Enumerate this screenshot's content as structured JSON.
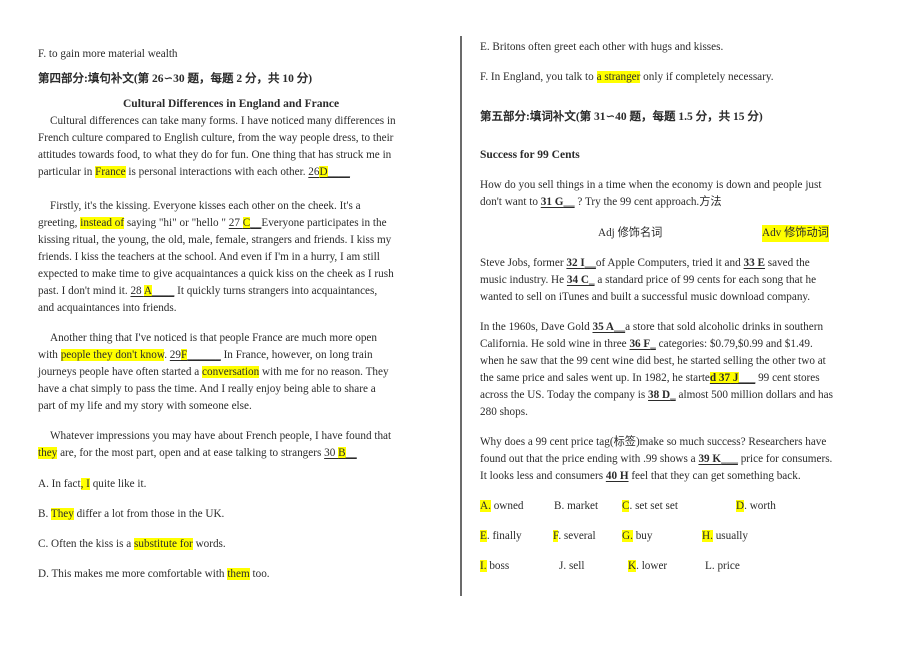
{
  "left": {
    "prev_option_f": "F. to gain more material wealth",
    "section4_heading": "第四部分:填句补文(第 26∽30 题，每题 2 分，共 10 分)",
    "passage_title": "Cultural Differences in England and France",
    "p1": {
      "l1": "Cultural differences can take many forms. I have noticed many differences in",
      "l2": "French culture compared to English culture, from the way people dress, to their",
      "l3": "attitudes towards food, to what they do for fun. One thing that has struck me in",
      "l4a": "particular in ",
      "l4hl": "France",
      "l4b": " is personal interactions with each other. ",
      "blank26_num": "26",
      "blank26_ans": "D",
      "blank26_tail": "____"
    },
    "p2": {
      "l1": "Firstly, it's the kissing. Everyone kisses each other on the cheek. It's a",
      "l2a": "greeting, ",
      "l2hl": "instead of",
      "l2b": " saying \"hi\" or \"hello \" ",
      "blank27_num": "27 ",
      "blank27_ans": "C",
      "blank27_tail": "__",
      "l2c": "Everyone participates in the",
      "l3": "kissing ritual, the young, the old, male, female, strangers and friends. I kiss my",
      "l4": "friends. I kiss the teachers at the school. And even if I'm in a hurry, I am still",
      "l5": "expected to make time to give acquaintances a quick kiss on the cheek as I rush",
      "l6a": "past. I don't mind it. ",
      "blank28_num": "28 ",
      "blank28_ans": "A",
      "blank28_tail": "____",
      "l6b": "  It quickly turns strangers into acquaintances,",
      "l7": "and acquaintances into friends."
    },
    "p3": {
      "l1": "Another thing that I've noticed is that people France are much more open",
      "l2a": "with ",
      "l2hl": "people they don't know",
      "l2b": ". ",
      "blank29_num": "29",
      "blank29_ans": "F",
      "blank29_tail": "______",
      "l2c": "  In France, however, on long train",
      "l3a": "journeys people have often started a ",
      "l3hl": "conversation",
      "l3b": " with me for no reason. They",
      "l4": "have a chat simply to pass the time. And I really enjoy being able to share a",
      "l5": "part of my life and my story with someone else."
    },
    "p4": {
      "l1": "Whatever impressions you may have about French people, I have found that",
      "l2hl": "they",
      "l2b": " are, for the most part, open and at ease talking to strangers ",
      "blank30_num": "30 ",
      "blank30_ans": "B",
      "blank30_tail": "__"
    },
    "options": [
      {
        "pre": "A. In fact",
        "hl": ", I",
        "post": " quite like it."
      },
      {
        "pre": "B. ",
        "hl": "They",
        "post": " differ a lot from those in the UK."
      },
      {
        "pre": "C. Often the kiss is a ",
        "hl": "substitute for",
        "post": " words."
      },
      {
        "pre": "D. This makes me more comfortable with ",
        "hl": "them",
        "post": " too."
      }
    ]
  },
  "right": {
    "option_e": "E. Britons often greet each other with hugs and kisses.",
    "option_f_pre": "F. In England, you talk to ",
    "option_f_hl": "a stranger",
    "option_f_post": " only if completely necessary.",
    "section5_heading": "第五部分:填词补文(第 31∽40 题，每题 1.5 分，共 15 分)",
    "passage_title": "Success for 99 Cents",
    "p1": {
      "l1": "How do you sell things in a time when the economy is down and people just",
      "l2a": "don't want to ",
      "blank31": "31 G",
      "blank31_tail": "__",
      "l2b": "  ? Try the 99 cent approach.方法"
    },
    "notes": {
      "adj": "Adj 修饰名词",
      "adv": "Adv 修饰动词"
    },
    "p2": {
      "l1a": "Steve Jobs, former ",
      "blank32": "32 I",
      "blank32_tail": "__",
      "l1b": "of Apple Computers, tried it and ",
      "blank33": "33 E",
      "l1c": " saved the",
      "l2a": "music industry. He ",
      "blank34": "34 C",
      "blank34_tail": "_",
      "l2b": "  a standard price of 99 cents for each song that he",
      "l3": "wanted to sell on iTunes and built a successful music download company."
    },
    "p3": {
      "l1a": "In the 1960s, Dave Gold ",
      "blank35": "35 A",
      "blank35_tail": "__",
      "l1b": "a store that sold alcoholic drinks in southern",
      "l2a": "California. He sold wine in three ",
      "blank36": "36 F",
      "blank36_tail": "_",
      "l2b": "  categories: $0.79,$0.99 and $1.49.",
      "l3": "when he saw that the 99 cent wine did best, he started selling the other two at",
      "l4a": "the same price and sales went up. In 1982, he starte",
      "l4hl": "d 37",
      "blank37": " J",
      "blank37_tail": "___",
      "l4b": "  99 cent stores",
      "l5a": "across the US. Today the company is ",
      "blank38": "38 D",
      "blank38_tail": "_",
      "l5b": "  almost 500 million dollars and has",
      "l6": "280 shops."
    },
    "p4": {
      "l1": "Why does a 99 cent price tag(标签)make so much success? Researchers have",
      "l2a": "found out that the price ending with .99 shows a ",
      "blank39": "39 K",
      "blank39_tail": "___",
      "l2b": "  price for consumers.",
      "l3a": "It looks less and consumers ",
      "blank40": "40 H",
      "l3b": " feel that they can get something back."
    },
    "word_bank": [
      {
        "letter": "A.",
        "word": " owned",
        "hl": true
      },
      {
        "letter": "B.",
        "word": " market",
        "hl": false
      },
      {
        "letter": "C",
        "word": ". set    set set",
        "hl": true
      },
      {
        "letter": "D",
        "word": ". worth",
        "hl": true
      },
      {
        "letter": "E",
        "word": ". finally",
        "hl": true
      },
      {
        "letter": "F",
        "word": ". several",
        "hl": true
      },
      {
        "letter": "G.",
        "word": " buy",
        "hl": true
      },
      {
        "letter": "H.",
        "word": " usually",
        "hl": true
      },
      {
        "letter": "I.",
        "word": " boss",
        "hl": true
      },
      {
        "letter": "J.",
        "word": " sell",
        "hl": false
      },
      {
        "letter": "K",
        "word": ". lower",
        "hl": true
      },
      {
        "letter": "L.",
        "word": " price",
        "hl": false
      }
    ]
  }
}
